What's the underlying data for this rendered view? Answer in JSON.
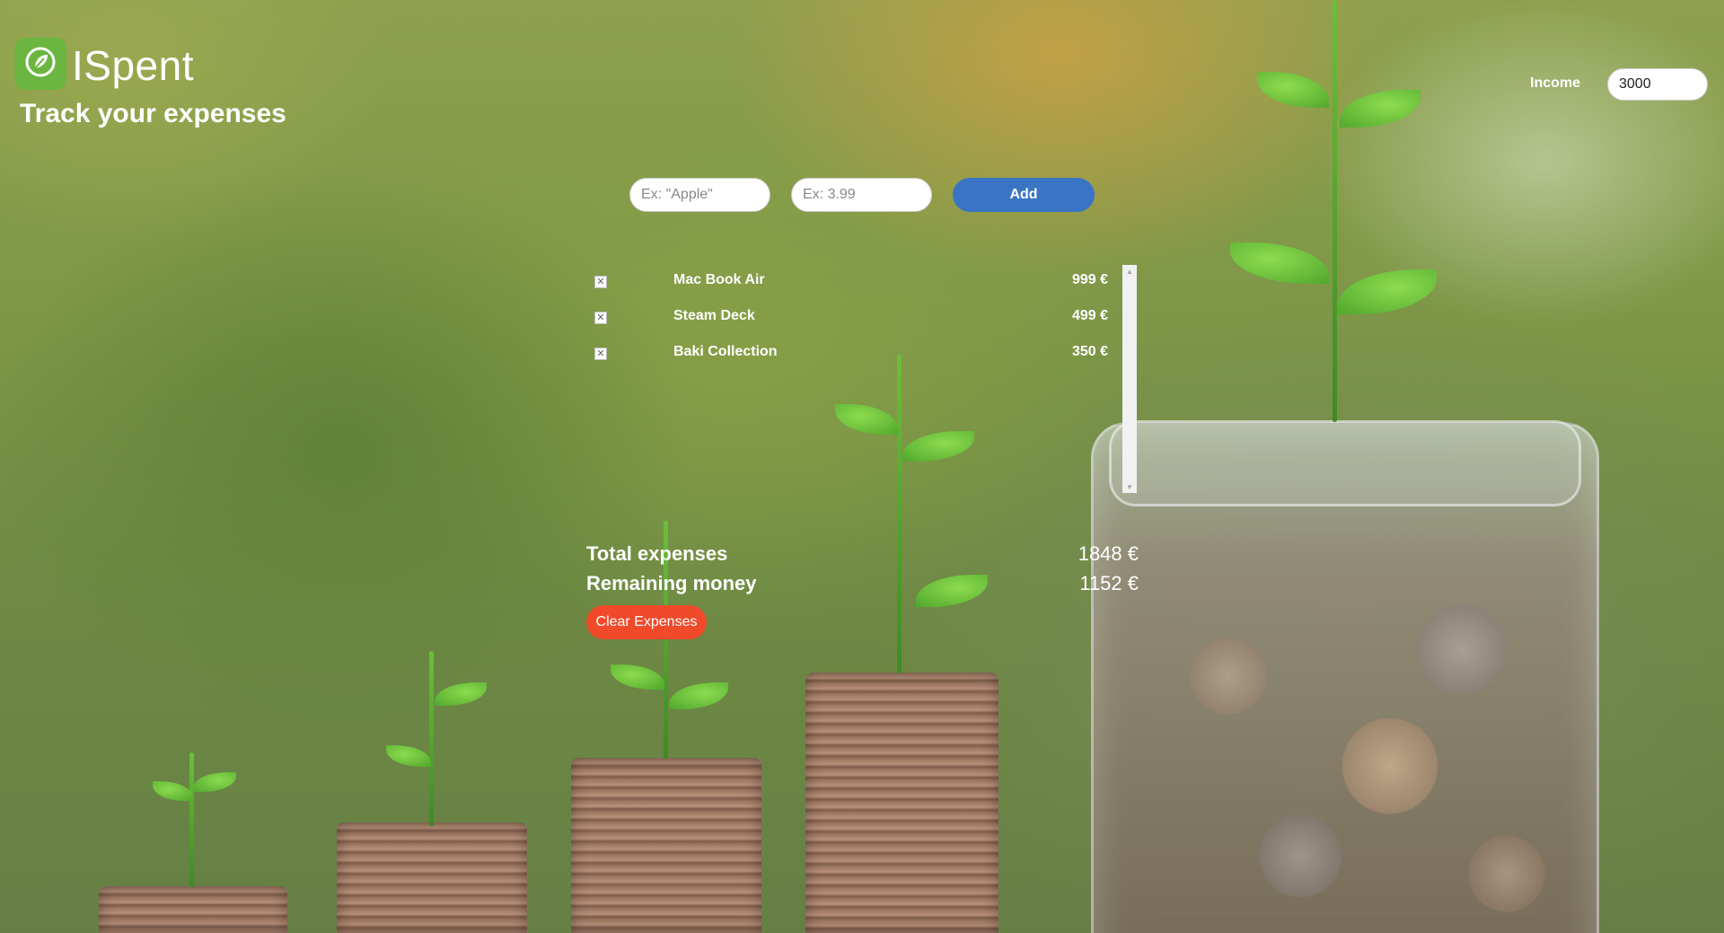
{
  "header": {
    "app_name": "ISpent",
    "tagline": "Track your expenses",
    "logo_icon": "leaf-coin-icon"
  },
  "income": {
    "label": "Income",
    "value": "3000"
  },
  "add_form": {
    "name_placeholder": "Ex: \"Apple\"",
    "name_value": "",
    "price_placeholder": "Ex: 3.99",
    "price_value": "",
    "add_label": "Add"
  },
  "expenses": [
    {
      "name": "Mac Book Air",
      "price": "999 €",
      "delete_icon": "close-icon"
    },
    {
      "name": "Steam Deck",
      "price": "499 €",
      "delete_icon": "close-icon"
    },
    {
      "name": "Baki Collection",
      "price": "350 €",
      "delete_icon": "close-icon"
    }
  ],
  "summary": {
    "total_label": "Total expenses",
    "total_value": "1848 €",
    "remaining_label": "Remaining money",
    "remaining_value": "1152 €",
    "clear_label": "Clear Expenses"
  },
  "colors": {
    "add_button": "#3a74c4",
    "clear_button": "#f04a2b",
    "logo_bg": "#6ab640"
  }
}
